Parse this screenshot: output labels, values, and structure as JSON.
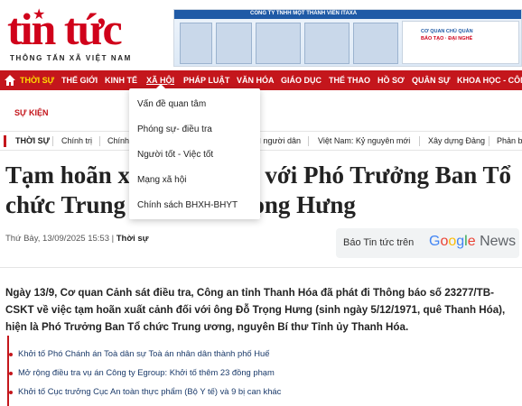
{
  "header": {
    "logo_title": "tin tức",
    "logo_subtitle": "THÔNG TẤN XÃ VIỆT NAM",
    "banner_line": "CÔNG TY TNHH MỘT THÀNH VIÊN ITAXA",
    "banner_card_line1": "CƠ QUAN CHỦ QUẢN",
    "banner_card_line2": "BÁO TẠO · ĐẠI NGHÉ"
  },
  "nav": {
    "items": [
      "THỜI SỰ",
      "THẾ GIỚI",
      "KINH TẾ",
      "XÃ HỘI",
      "PHÁP LUẬT",
      "VĂN HÓA",
      "GIÁO DỤC",
      "THỂ THAO",
      "HỒ SƠ",
      "QUÂN SỰ",
      "KHOA HỌC - CÔNG"
    ]
  },
  "dropdown": {
    "items": [
      "Vấn đề quan tâm",
      "Phóng sự- điều tra",
      "Người tốt - Việc tốt",
      "Mạng xã hội",
      "Chính sách BHXH-BHYT"
    ]
  },
  "subheader": {
    "label": "SỰ KIỆN"
  },
  "topics": {
    "items": [
      "THỜI SỰ",
      "Chính trị",
      "Chính",
      "vì người dân",
      "Việt Nam: Kỷ nguyên mới",
      "Xây dựng Đảng",
      "Phản b"
    ]
  },
  "article": {
    "headline": "Tạm hoãn xuất cảnh đối với Phó Trưởng Ban Tổ chức Trung ương Đỗ Trọng Hưng",
    "headline_visible_1": "Tạm hoãn x",
    "headline_visible_2": "ới Phó Trưởng Ban Tổ",
    "headline_visible_3": "chức Trung",
    "headline_visible_4": "ng Hưng",
    "date": "Thứ Bảy, 13/09/2025 15:53",
    "category": "Thời sự",
    "lead": "Ngày 13/9, Cơ quan Cảnh sát điều tra, Công an tỉnh Thanh Hóa đã phát đi Thông báo số 23277/TB-CSKT về việc tạm hoãn xuất cảnh đối với ông Đỗ Trọng Hưng (sinh ngày 5/12/1971, quê Thanh Hóa), hiện là Phó Trưởng Ban Tổ chức Trung ương, nguyên Bí thư Tỉnh ủy Thanh Hóa."
  },
  "gnews": {
    "label": "Báo Tin tức trên",
    "brand": "Google News"
  },
  "related": {
    "items": [
      "Khởi tố Phó Chánh án Toà dân sự Toà án nhân dân thành phố Huế",
      "Mở rộng điều tra vụ án Công ty Egroup: Khởi tố thêm 23 đồng phạm",
      "Khởi tố Cục trưởng Cục An toàn thực phẩm (Bộ Y tế) và 9 bị can khác"
    ]
  },
  "colors": {
    "brand_red": "#c4161c",
    "nav_active": "#ffde00",
    "link_blue": "#1a3a6a"
  }
}
